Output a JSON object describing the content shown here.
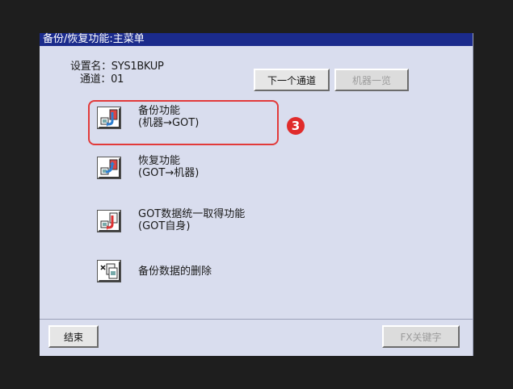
{
  "window": {
    "title": "备份/恢复功能:主菜单"
  },
  "info": {
    "setting_name": "设置名：SYS1BKUP",
    "channel": "通道：01"
  },
  "buttons": {
    "next_channel": "下一个通道",
    "device_list": "机器一览",
    "end": "结束",
    "fx_key": "FX关键字"
  },
  "menu": [
    {
      "icon": "backup-icon",
      "line1": "备份功能",
      "line2": "(机器→GOT)"
    },
    {
      "icon": "restore-icon",
      "line1": "恢复功能",
      "line2": "(GOT→机器)"
    },
    {
      "icon": "got-data-icon",
      "line1": "GOT数据统一取得功能",
      "line2": "(GOT自身)"
    },
    {
      "icon": "delete-backup-icon",
      "line1": "备份数据的删除",
      "line2": ""
    }
  ],
  "annotation": {
    "marker": "3",
    "color": "#e23a3a"
  },
  "colors": {
    "titlebar": "#1b2b8c",
    "panel": "#d9ddee",
    "highlight": "#e23a3a"
  }
}
